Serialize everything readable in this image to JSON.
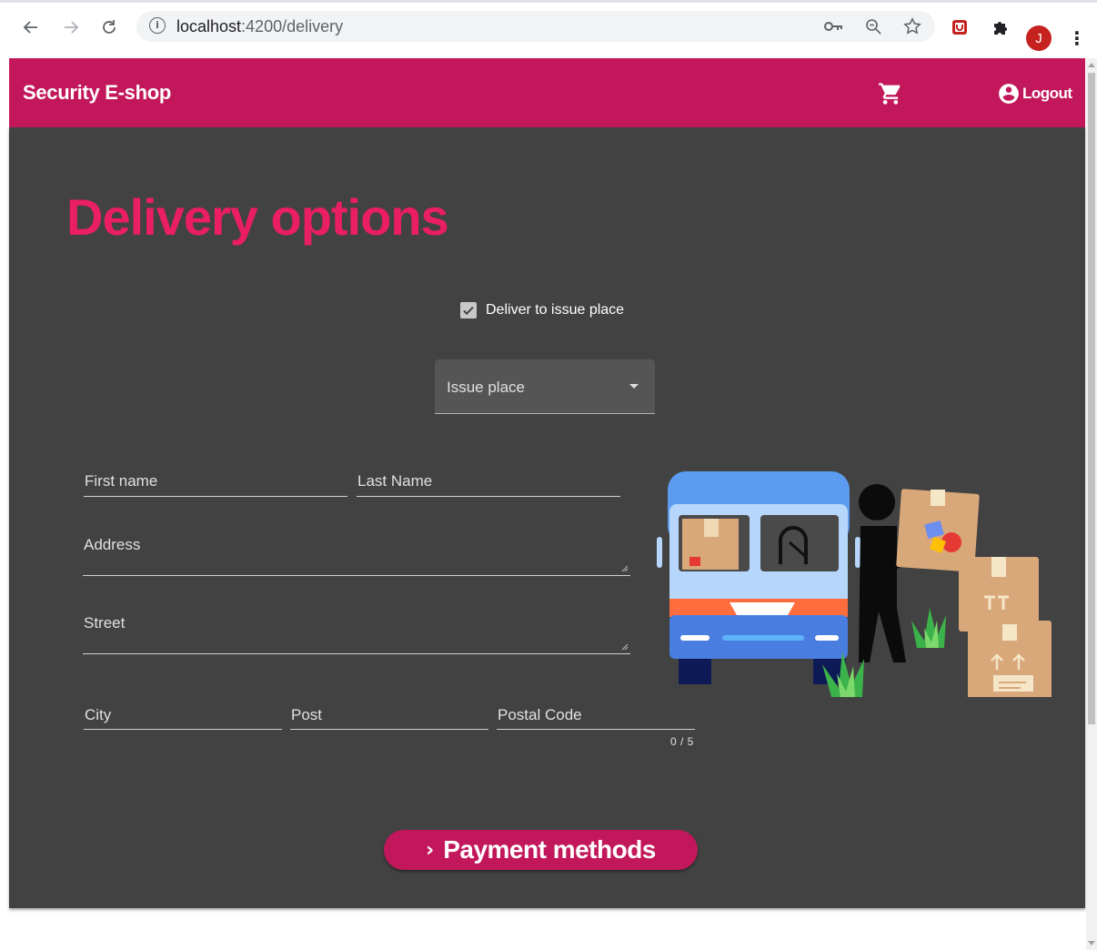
{
  "browser": {
    "url_host": "localhost",
    "url_path": ":4200/delivery",
    "avatar_initial": "J"
  },
  "toolbar": {
    "brand": "Security E-shop",
    "logout_label": "Logout"
  },
  "page": {
    "title": "Delivery options",
    "checkbox_label": "Deliver to issue place",
    "checkbox_checked": true,
    "issue_place_label": "Issue place",
    "fields": {
      "first_name": "First name",
      "last_name": "Last Name",
      "address": "Address",
      "street": "Street",
      "city": "City",
      "post": "Post",
      "postal_code": "Postal Code",
      "postal_code_hint": "0 / 5"
    },
    "payment_button": "Payment methods"
  },
  "colors": {
    "primary": "#c2185b",
    "accent": "#e91e63",
    "background": "#424242"
  },
  "icons": [
    "back-arrow-icon",
    "forward-arrow-icon",
    "reload-icon",
    "info-icon",
    "key-icon",
    "zoom-icon",
    "star-icon",
    "extension-shield-icon",
    "puzzle-icon",
    "cart-icon",
    "account-circle-icon",
    "chevron-right-icon",
    "delivery-illustration"
  ]
}
